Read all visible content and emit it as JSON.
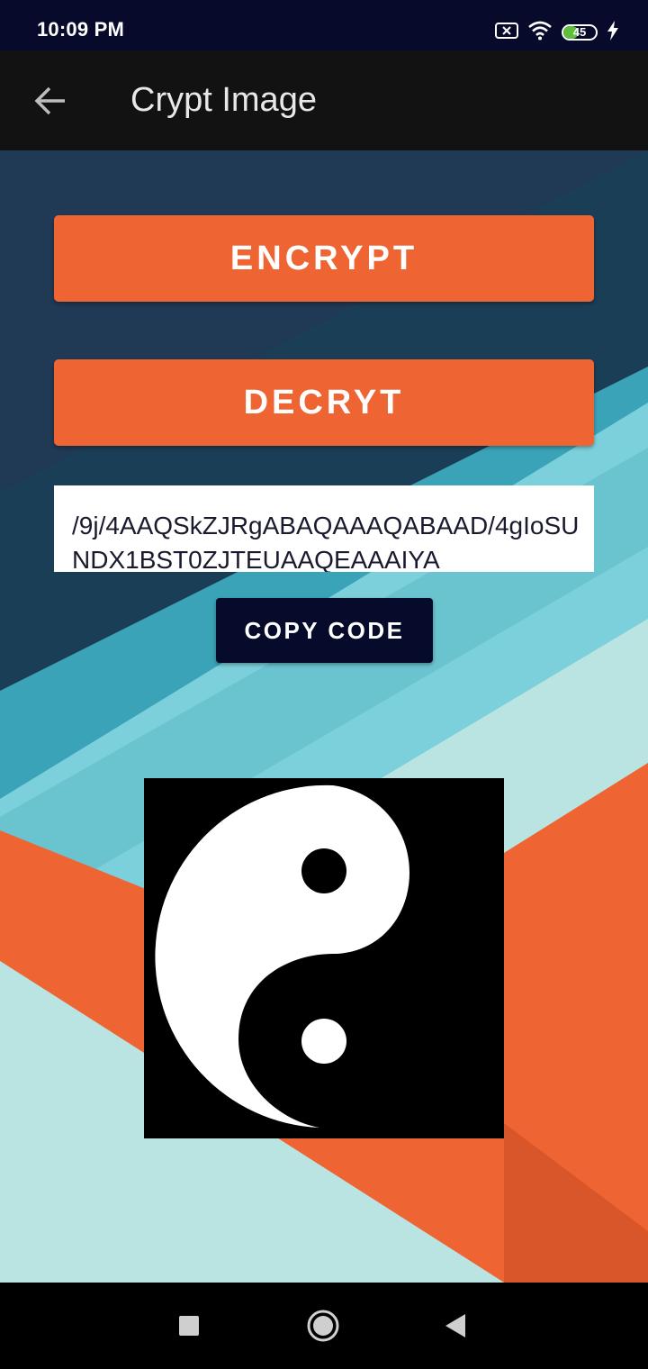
{
  "status_bar": {
    "time": "10:09 PM",
    "battery_level": "45",
    "battery_fraction": 0.45,
    "icons": [
      "sim-blocked-icon",
      "wifi-icon",
      "battery-icon",
      "charging-icon"
    ]
  },
  "app_bar": {
    "title": "Crypt Image",
    "back_icon": "arrow-back-icon"
  },
  "actions": {
    "encrypt_label": "ENCRYPT",
    "decrypt_label": "DECRYT",
    "copy_label": "COPY CODE"
  },
  "code": {
    "value": "/9j/4AAQSkZJRgABAQAAAQABAAD/4gIoSUNDX1BST0ZJTEUAAQEAAAIYA"
  },
  "image": {
    "subject": "yin-yang-symbol"
  },
  "nav_bar": {
    "icons": [
      "recents-square-icon",
      "home-circle-icon",
      "back-triangle-icon"
    ]
  },
  "colors": {
    "accent_orange": "#ee6533",
    "dark_navy": "#060b2c",
    "app_bar_bg": "#121212"
  }
}
